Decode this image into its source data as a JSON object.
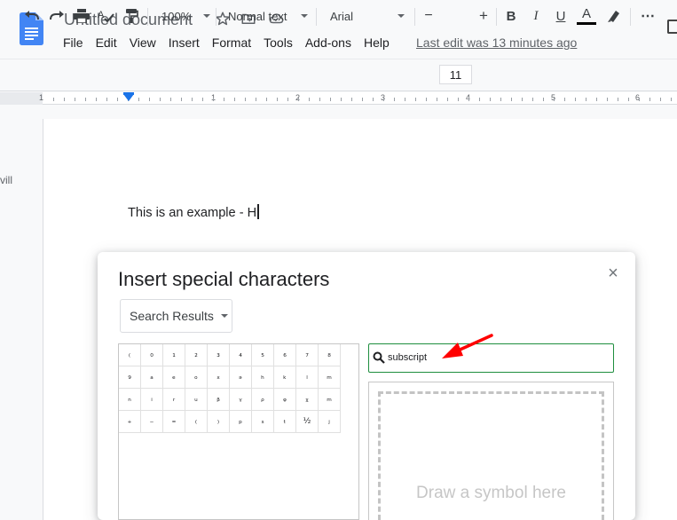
{
  "doc": {
    "title": "Untitled document",
    "last_edit": "Last edit was 13 minutes ago"
  },
  "menu": [
    "File",
    "Edit",
    "View",
    "Insert",
    "Format",
    "Tools",
    "Add-ons",
    "Help"
  ],
  "toolbar": {
    "zoom": "100%",
    "style": "Normal text",
    "font": "Arial",
    "font_size": "11",
    "minus": "−",
    "plus": "+",
    "bold": "B",
    "italic": "I",
    "underline": "U",
    "text_color": "A",
    "more": "⋯"
  },
  "ruler": {
    "numbers": [
      "1",
      "1",
      "2",
      "3",
      "4",
      "5",
      "6"
    ]
  },
  "page": {
    "side_text": "vill",
    "body_text": "This is an example - H"
  },
  "dialog": {
    "title": "Insert special characters",
    "close": "×",
    "category": "Search Results",
    "search_value": "subscript",
    "draw_hint": "Draw a symbol here",
    "characters": [
      "₍",
      "₀",
      "₁",
      "₂",
      "₃",
      "₄",
      "₅",
      "₆",
      "₇",
      "₈",
      "₉",
      "ₐ",
      "ₑ",
      "ₒ",
      "ₓ",
      "ₔ",
      "ₕ",
      "ₖ",
      "ₗ",
      "ₘ",
      "ₙ",
      "ᵢ",
      "ᵣ",
      "ᵤ",
      "ᵦ",
      "ᵧ",
      "ᵨ",
      "ᵩ",
      "ᵪ",
      "ₘ",
      "₊",
      "₋",
      "₌",
      "₍",
      "₎",
      "ₚ",
      "ₛ",
      "ₜ",
      "⅟₂",
      "ⱼ"
    ]
  },
  "colors": {
    "accent": "#1a73e8",
    "doc_blue": "#4285f4",
    "search_border": "#1e8e3e",
    "arrow_red": "#ff0000"
  }
}
